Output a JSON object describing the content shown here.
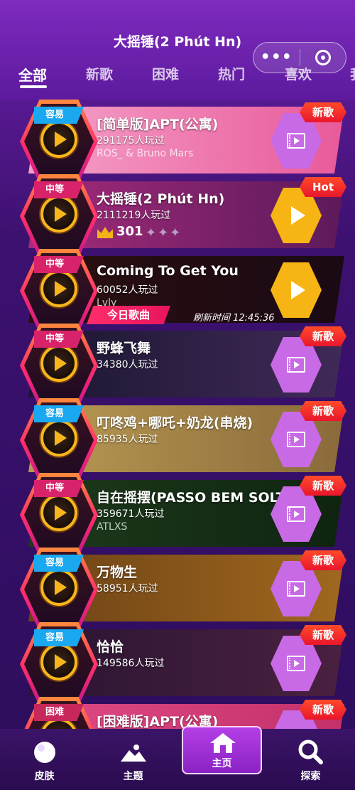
{
  "header": {
    "title": "大摇锤(2 Phút Hn)",
    "menu_icon": "more-dots-icon",
    "close_icon": "target-ring-icon"
  },
  "tabs": [
    {
      "label": "全部",
      "active": true
    },
    {
      "label": "新歌",
      "active": false
    },
    {
      "label": "困难",
      "active": false
    },
    {
      "label": "热门",
      "active": false
    },
    {
      "label": "喜欢",
      "active": false
    },
    {
      "label": "我",
      "active": false
    }
  ],
  "songs": [
    {
      "difficulty": "容易",
      "name": "[简单版]APT(公寓)",
      "plays": "291175人玩过",
      "artist": "ROS_ & Bruno Mars",
      "badge": "新歌",
      "button": "video",
      "colors": [
        "#f5a1c8",
        "#e85a9b"
      ]
    },
    {
      "difficulty": "中等",
      "name": "大摇锤(2 Phút Hn)",
      "plays": "2111219人玩过",
      "crown_count": "301",
      "stars": "✦✦✦",
      "badge": "Hot",
      "button": "play",
      "colors": [
        "#a42b7c",
        "#5d1a5a"
      ]
    },
    {
      "difficulty": "中等",
      "name": "Coming To Get You",
      "plays": "60052人玩过",
      "artist": "Lvly",
      "today_label": "今日歌曲",
      "refresh_text": "刷新时间 12:45:36",
      "badge": "",
      "button": "play",
      "colors": [
        "#2b0f10",
        "#1a0a14"
      ]
    },
    {
      "difficulty": "中等",
      "name": "野蜂飞舞",
      "plays": "34380人玩过",
      "badge": "新歌",
      "button": "video",
      "colors": [
        "#1b1630",
        "#402a58"
      ]
    },
    {
      "difficulty": "容易",
      "name": "叮咚鸡+哪吒+奶龙(串烧)",
      "plays": "85935人玩过",
      "badge": "新歌",
      "button": "video",
      "colors": [
        "#b99a52",
        "#8a6a3a"
      ]
    },
    {
      "difficulty": "中等",
      "name": "自在摇摆(PASSO BEM SOLTO)",
      "plays": "359671人玩过",
      "artist": "ATLXS",
      "badge": "新歌",
      "button": "video",
      "colors": [
        "#1d3a1c",
        "#0f2410"
      ]
    },
    {
      "difficulty": "容易",
      "name": "万物生",
      "plays": "58951人玩过",
      "badge": "新歌",
      "button": "video",
      "colors": [
        "#6d4215",
        "#a0681f"
      ]
    },
    {
      "difficulty": "容易",
      "name": "恰恰",
      "plays": "149586人玩过",
      "badge": "新歌",
      "button": "video",
      "colors": [
        "#2a1532",
        "#4a2040"
      ]
    },
    {
      "difficulty": "困难",
      "name": "[困难版]APT(公寓)",
      "plays": "",
      "badge": "新歌",
      "button": "video",
      "colors": [
        "#e04a86",
        "#c4316a"
      ]
    }
  ],
  "bottom_nav": [
    {
      "label": "皮肤",
      "icon": "skin-circle-icon"
    },
    {
      "label": "主题",
      "icon": "mountain-theme-icon"
    },
    {
      "label": "主页",
      "icon": "home-icon",
      "active": true
    },
    {
      "label": "探索",
      "icon": "search-icon"
    }
  ],
  "accent": "#f9b61c"
}
